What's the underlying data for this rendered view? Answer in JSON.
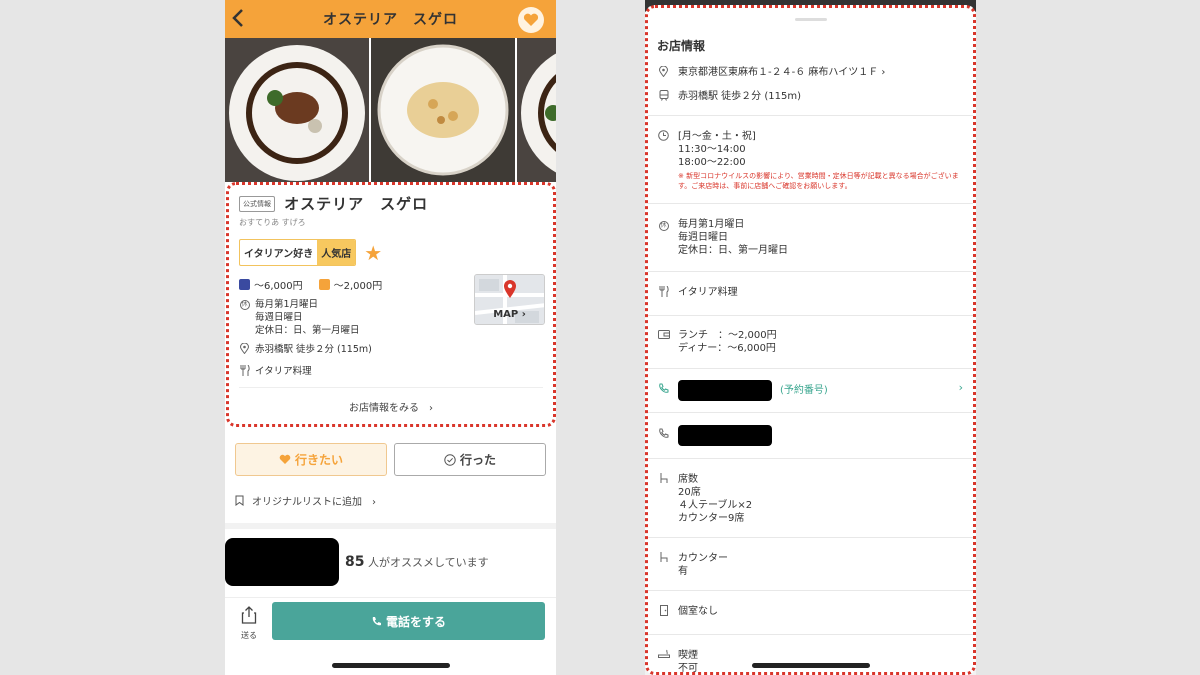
{
  "left": {
    "header": {
      "title": "オステリア　スゲロ",
      "back_icon": "chevron-left-icon",
      "fav_icon": "heart-icon"
    },
    "card": {
      "badge": "公式情報",
      "name": "オステリア　スゲロ",
      "kana": "おすてりあ すげろ",
      "tag1": "イタリアン好き",
      "tag2": "人気店",
      "dinner_price": "～6,000円",
      "lunch_price": "～2,000円",
      "holiday_lines": [
        "毎月第1月曜日",
        "毎週日曜日",
        "定休日：日、第一月曜日"
      ],
      "holiday_icon_label": "休",
      "station": "赤羽橋駅 徒歩２分 (115m)",
      "genre": "イタリア料理",
      "map_label": "MAP ›",
      "more_link": "お店情報をみる　›"
    },
    "buttons": {
      "want": "行きたい",
      "went": "行った"
    },
    "add_list": "オリジナルリストに追加　›",
    "recommend_count": "85",
    "recommend_text": "人がオススメしています",
    "send_label": "送る",
    "call_label": "電話をする"
  },
  "right": {
    "title": "お店情報",
    "address": "東京都港区東麻布１-２４-６ 麻布ハイツ１Ｆ ›",
    "station": "赤羽橋駅 徒歩２分 (115m)",
    "hours": [
      "[月～金・土・祝]",
      "11:30～14:00",
      "18:00～22:00"
    ],
    "hours_note": "※ 新型コロナウイルスの影響により、営業時間・定休日等が記載と異なる場合がございます。ご来店時は、事前に店舗へご確認をお願いします。",
    "holidays": [
      "毎月第1月曜日",
      "毎週日曜日",
      "定休日：日、第一月曜日"
    ],
    "holiday_icon_label": "休",
    "genre": "イタリア料理",
    "lunch": "ランチ　：～2,000円",
    "dinner": "ディナー：～6,000円",
    "reserve_label": "(予約番号)",
    "seats": [
      "席数",
      "20席",
      "４人テーブル×2",
      "カウンター9席"
    ],
    "counter": [
      "カウンター",
      "有"
    ],
    "private_room": "個室なし",
    "smoking": [
      "喫煙",
      "不可"
    ]
  }
}
